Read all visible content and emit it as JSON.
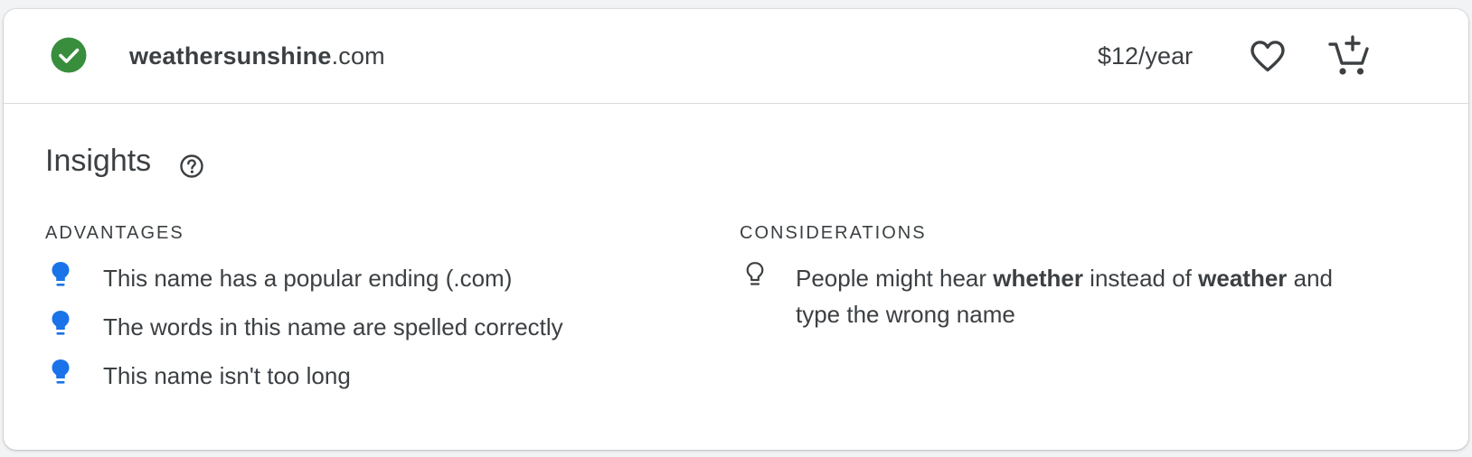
{
  "header": {
    "domain_sld": "weathersunshine",
    "domain_tld": ".com",
    "price": "$12/year",
    "status_color": "#388e3c",
    "icons": {
      "status": "check-circle-icon",
      "favorite": "heart-icon",
      "cart": "add-to-cart-icon"
    }
  },
  "insights": {
    "title": "Insights",
    "help_icon": "help-circle-icon",
    "advantages": {
      "label": "ADVANTAGES",
      "icon": "lightbulb-filled-icon",
      "icon_color": "#1a73e8",
      "items": [
        "This name has a popular ending (.com)",
        "The words in this name are spelled correctly",
        "This name isn't too long"
      ]
    },
    "considerations": {
      "label": "CONSIDERATIONS",
      "icon": "lightbulb-outline-icon",
      "items": [
        {
          "before": "People might hear ",
          "bold1": "whether",
          "middle": " instead of ",
          "bold2": "weather",
          "after_line1": " and",
          "line2": "type the wrong name"
        }
      ]
    }
  }
}
